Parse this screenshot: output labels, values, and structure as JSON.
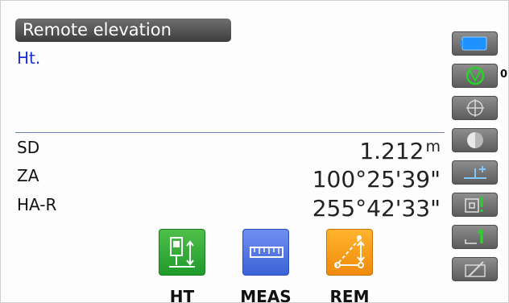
{
  "header": {
    "title": "Remote elevation",
    "subtitle": "Ht."
  },
  "measurements": [
    {
      "label": "SD",
      "value": "1.212",
      "unit": "m"
    },
    {
      "label": "ZA",
      "value": "100°25'39\"",
      "unit": ""
    },
    {
      "label": "HA-R",
      "value": "255°42'33\"",
      "unit": ""
    }
  ],
  "sidebar": {
    "items": [
      {
        "icon": "battery-icon"
      },
      {
        "icon": "prism-target-icon",
        "count": "0"
      },
      {
        "icon": "crosshair-icon"
      },
      {
        "icon": "half-circle-icon"
      },
      {
        "icon": "tilt-offset-icon"
      },
      {
        "icon": "laser-pointer-icon"
      },
      {
        "icon": "level-one-icon"
      },
      {
        "icon": "keyboard-pen-icon"
      }
    ]
  },
  "function_keys": [
    {
      "label": "HT",
      "icon": "instrument-height-icon",
      "color": "#2eaa38"
    },
    {
      "label": "MEAS",
      "icon": "ruler-icon",
      "color": "#4a6fe0"
    },
    {
      "label": "REM",
      "icon": "remote-elevation-icon",
      "color": "#f69a14"
    }
  ],
  "colors": {
    "title_bg": "#4a4a4a",
    "subtitle": "#1a2fd0",
    "divider": "#6d7fb2",
    "battery": "#1e90ff",
    "target_ring": "#2bd02b"
  }
}
